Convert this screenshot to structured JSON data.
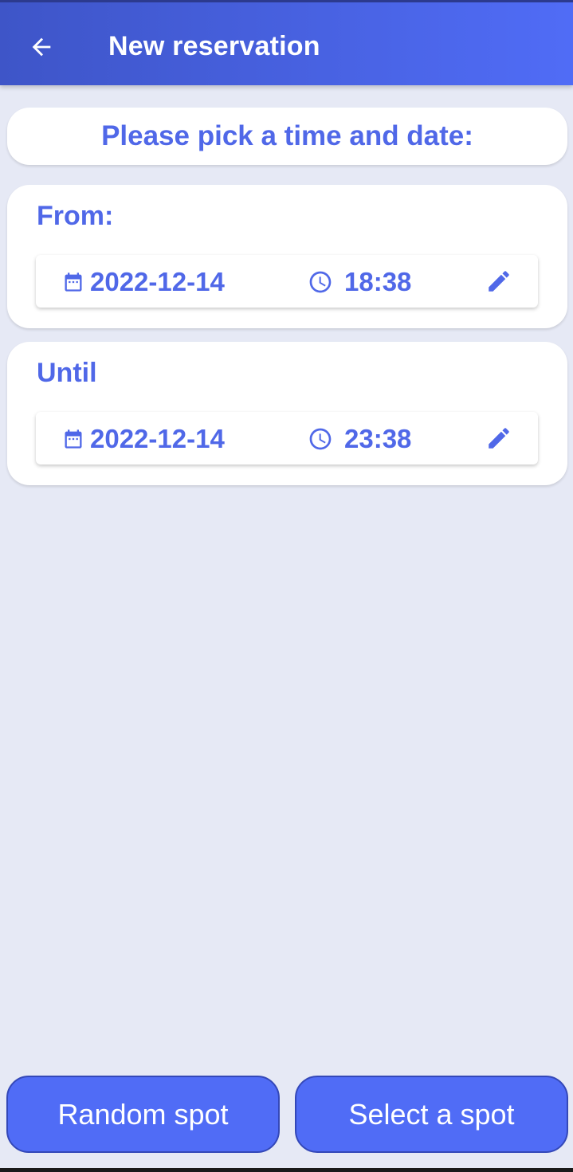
{
  "header": {
    "title": "New reservation",
    "back_icon": "arrow-left-icon"
  },
  "prompt": {
    "text": "Please pick a time and date:"
  },
  "from": {
    "label": "From:",
    "date": "2022-12-14",
    "time": "18:38",
    "date_icon": "calendar-icon",
    "time_icon": "clock-icon",
    "edit_icon": "pencil-icon"
  },
  "until": {
    "label": "Until",
    "date": "2022-12-14",
    "time": "23:38",
    "date_icon": "calendar-icon",
    "time_icon": "clock-icon",
    "edit_icon": "pencil-icon"
  },
  "actions": {
    "random_label": "Random spot",
    "select_label": "Select a spot"
  },
  "colors": {
    "accent": "#506cf6",
    "accent_text": "#5068e8",
    "background": "#e6e9f5"
  }
}
